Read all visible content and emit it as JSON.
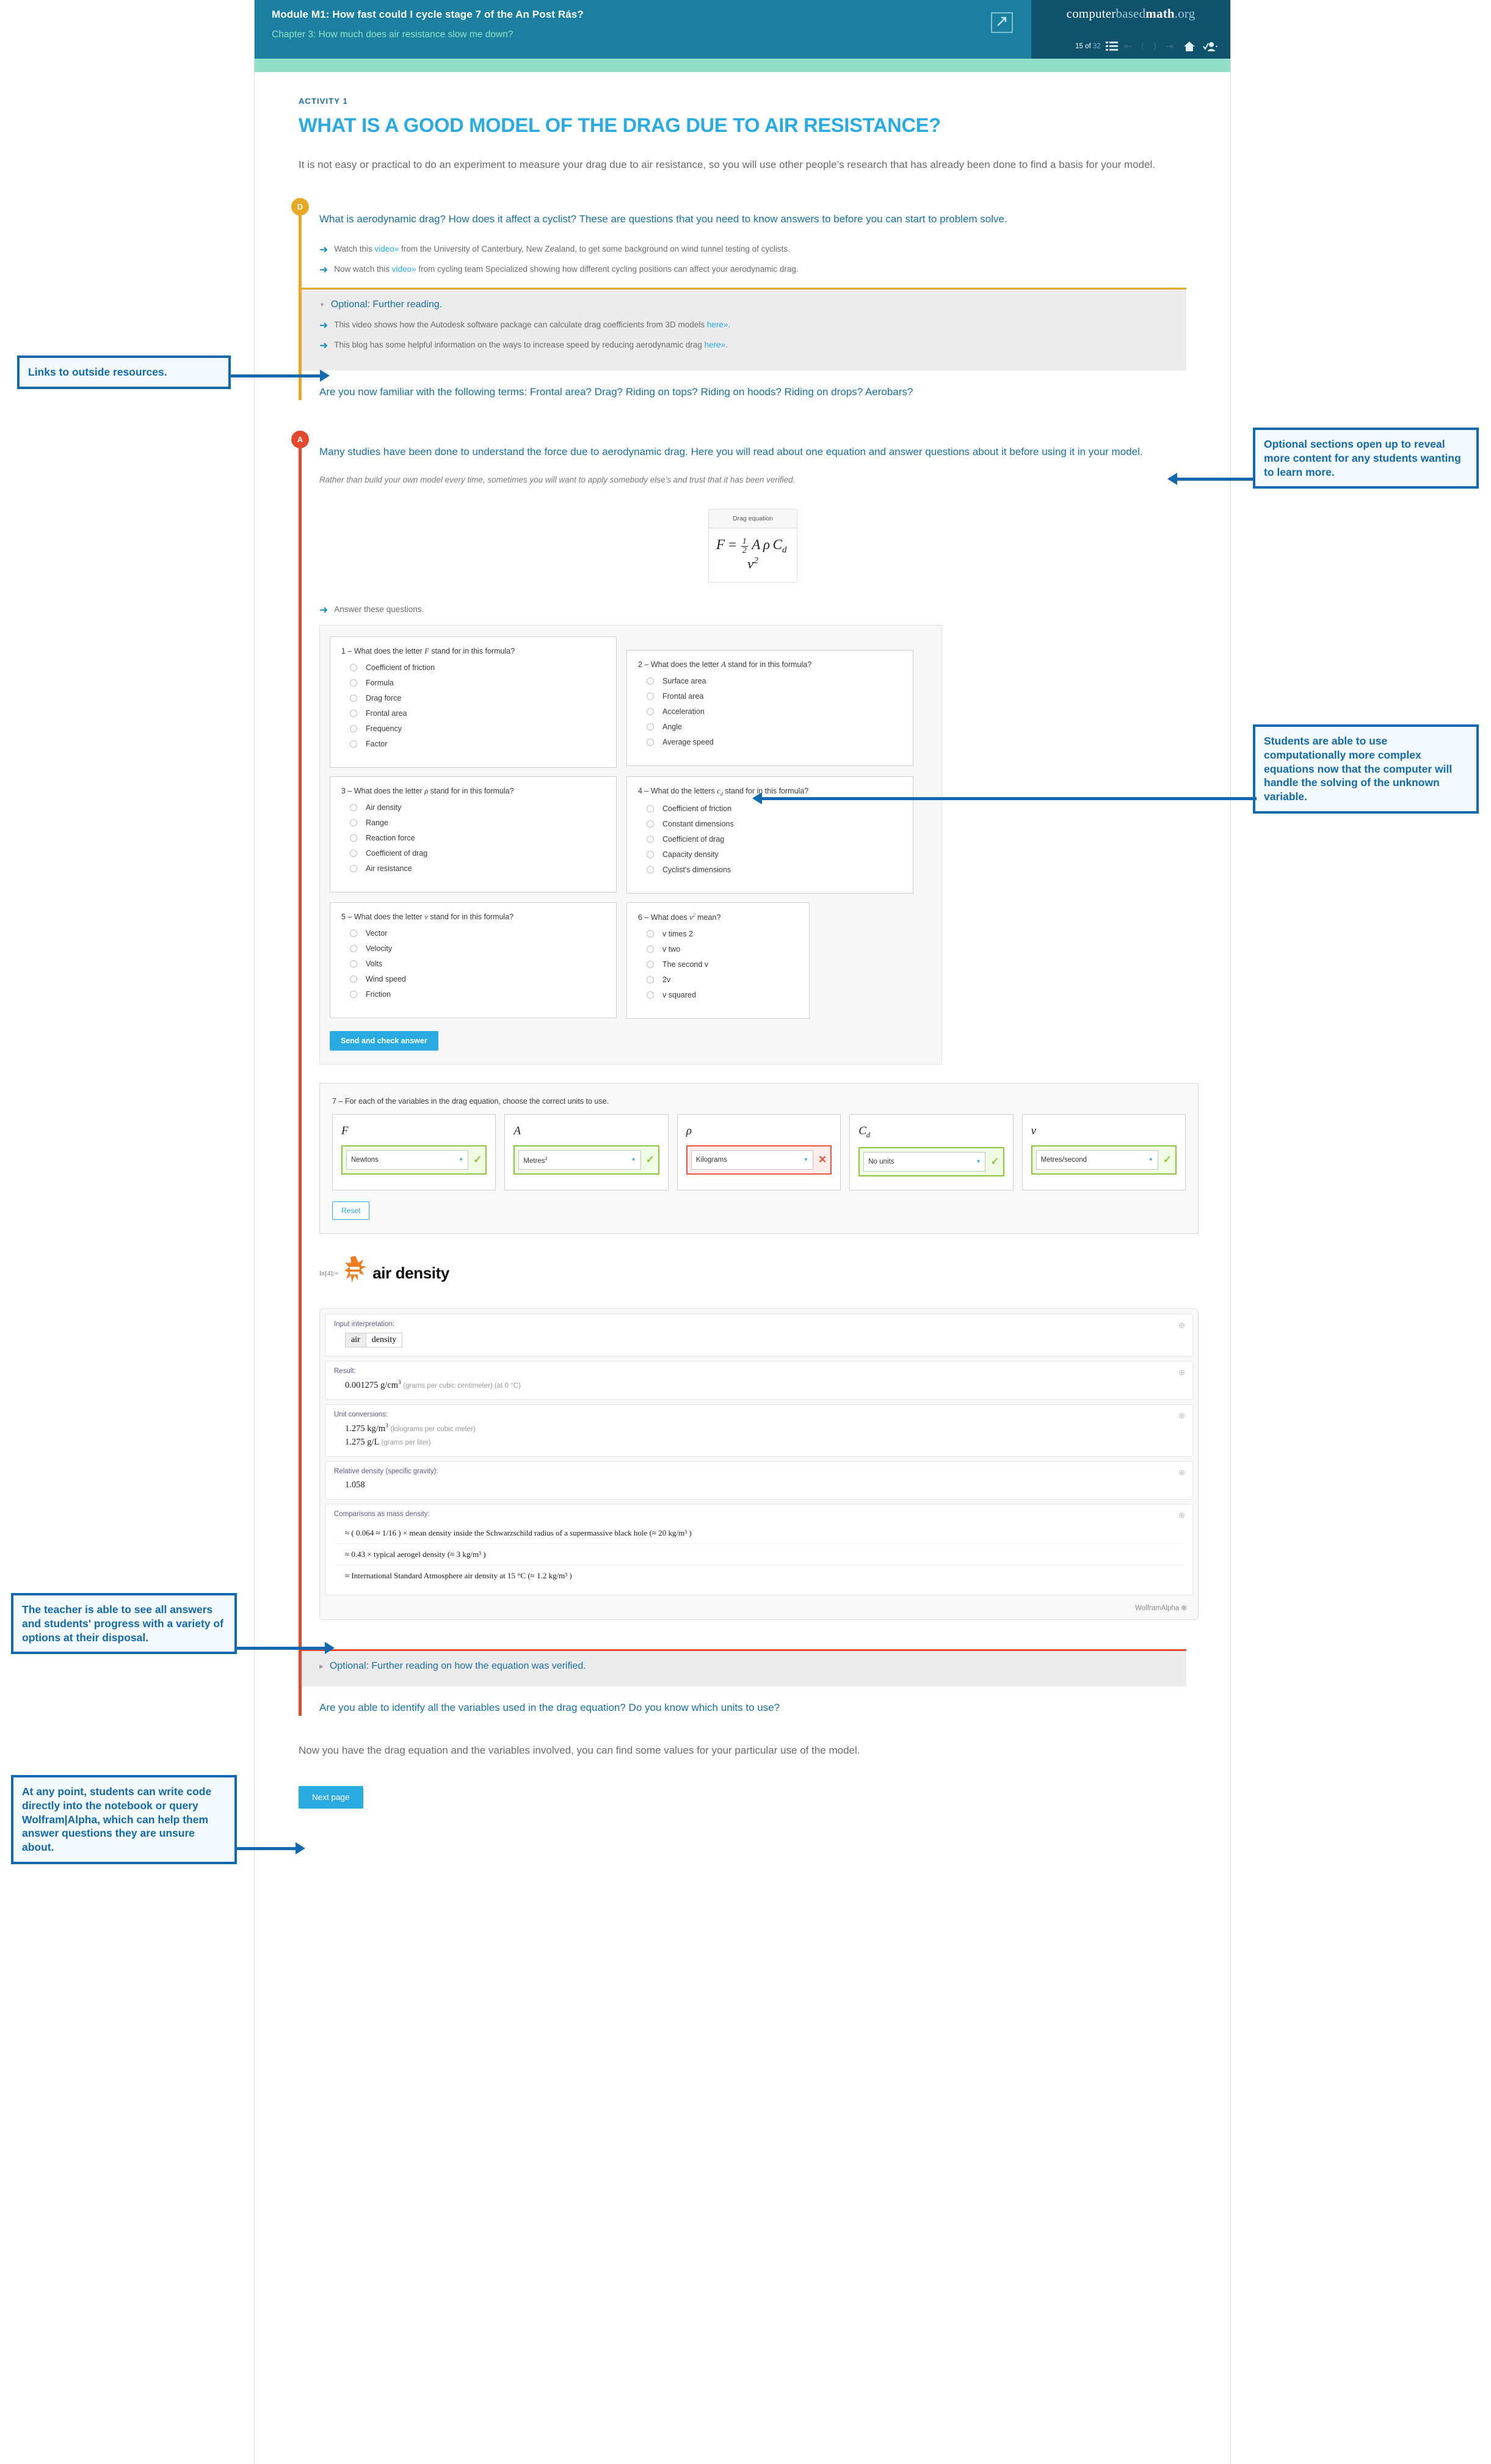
{
  "header": {
    "module_title": "Module M1: How fast could I cycle stage 7 of the An Post Rás?",
    "chapter_title": "Chapter 3: How much does air resistance slow me down?",
    "brand_computer": "computer",
    "brand_based": "based",
    "brand_math": "math",
    "brand_org": ".org",
    "page_current": "15 of",
    "page_total": "32",
    "expand_icon": "external-link-icon",
    "nav": [
      "list-icon",
      "first-page-icon",
      "prev-page-icon",
      "next-page-icon",
      "last-page-icon",
      "home-icon",
      "user-account-icon"
    ]
  },
  "page": {
    "kicker": "ACTIVITY 1",
    "title": "WHAT IS A GOOD MODEL OF THE DRAG DUE TO AIR RESISTANCE?",
    "intro": "It is not easy or practical to do an experiment to measure your drag due to air resistance, so you will use other people’s research that has already been done to find a basis for your model."
  },
  "section_d": {
    "badge": "D",
    "lead": "What is aerodynamic drag? How does it affect a cyclist? These are questions that you need to know answers to before you can start to problem solve.",
    "bullets": [
      {
        "pre": "Watch this ",
        "link": "video»",
        "post": " from the University of Canterbury, New Zealand, to get some background on wind tunnel testing of cyclists."
      },
      {
        "pre": "Now watch this ",
        "link": "video»",
        "post": " from cycling team Specialized showing how different cycling positions can affect your aerodynamic drag."
      }
    ],
    "optional_heading": "Optional: Further reading.",
    "optional_bullets": [
      {
        "pre": "This video shows how the Autodesk software package can calculate drag coefficients from 3D models ",
        "link": "here»",
        "post": "."
      },
      {
        "pre": "This blog has some helpful information on the ways to increase speed by reducing aerodynamic drag ",
        "link": "here»",
        "post": "."
      }
    ],
    "closing": "Are you now familiar with the following terms: Frontal area? Drag? Riding on tops? Riding on hoods? Riding on drops? Aerobars?"
  },
  "section_a": {
    "badge": "A",
    "lead": "Many studies have been done to understand the force due to aerodynamic drag. Here you will read about one equation and answer questions about it before using it in your model.",
    "note": "Rather than build your own model every time, sometimes you will want to apply somebody else’s and trust that it has been verified.",
    "equation_card_title": "Drag equation",
    "equation_plain": "F = 1/2 A ρ C_d v^2",
    "answer_prompt": "Answer these questions."
  },
  "quiz": {
    "questions": [
      {
        "num": "1",
        "prompt_pre": "1 – What does the letter ",
        "var": "F",
        "prompt_post": " stand for in this formula?",
        "options": [
          "Coefficient of friction",
          "Formula",
          "Drag force",
          "Frontal area",
          "Frequency",
          "Factor"
        ]
      },
      {
        "num": "2",
        "prompt_pre": "2 – What does the letter ",
        "var": "A",
        "prompt_post": " stand for in this formula?",
        "options": [
          "Surface area",
          "Frontal area",
          "Acceleration",
          "Angle",
          "Average speed"
        ]
      },
      {
        "num": "3",
        "prompt_pre": "3 – What does the letter ",
        "var": "ρ",
        "prompt_post": " stand for in this formula?",
        "options": [
          "Air density",
          "Range",
          "Reaction force",
          "Coefficient of drag",
          "Air resistance"
        ]
      },
      {
        "num": "4",
        "prompt_pre": "4 – What do the letters ",
        "var": "cₓ",
        "prompt_post": " stand for in this formula?",
        "options": [
          "Coefficient of friction",
          "Constant dimensions",
          "Coefficient of drag",
          "Capacity density",
          "Cyclist's dimensions"
        ]
      },
      {
        "num": "5",
        "prompt_pre": "5 – What does the letter ",
        "var": "v",
        "prompt_post": " stand for in this formula?",
        "options": [
          "Vector",
          "Velocity",
          "Volts",
          "Wind speed",
          "Friction"
        ]
      },
      {
        "num": "6",
        "prompt_pre": "6 – What does ",
        "var": "v²",
        "prompt_post": " mean?",
        "options": [
          "v times 2",
          "v two",
          "The second v",
          "2v",
          "v squared"
        ]
      }
    ],
    "send_label": "Send and check answer"
  },
  "units": {
    "question": "7 – For each of the variables in the drag equation, choose the correct units to use.",
    "fields": [
      {
        "var": "F",
        "value": "Newtons",
        "state": "correct",
        "mark": "✓"
      },
      {
        "var": "A",
        "value": "Metres²",
        "state": "correct",
        "mark": "✓"
      },
      {
        "var": "ρ",
        "value": "Kilograms",
        "state": "incorrect",
        "mark": "✕"
      },
      {
        "var": "C_d",
        "value": "No units",
        "state": "correct",
        "mark": "✓"
      },
      {
        "var": "v",
        "value": "Metres/second",
        "state": "correct",
        "mark": "✓"
      }
    ],
    "reset_label": "Reset"
  },
  "wolfram": {
    "in_label": "In[4]:=",
    "query": "air density",
    "pods": [
      {
        "title": "Input interpretation:",
        "chip": [
          "air",
          "density"
        ]
      },
      {
        "title": "Result:",
        "value": "0.001275 g/cm",
        "sup": "3",
        "note": "(grams per cubic centimeter)  (at 0 °C)"
      },
      {
        "title": "Unit conversions:",
        "value": "1.275 kg/m",
        "sup": "3",
        "note": "(kilograms per cubic meter)",
        "value2": "1.275 g/L",
        "note2": "(grams per liter)"
      },
      {
        "title": "Relative density (specific gravity):",
        "value": "1.058"
      },
      {
        "title": "Comparisons as mass density:",
        "comparisons": [
          "≈ ( 0.064 ≈ 1/16 ) × mean density inside the Schwarzschild radius of a supermassive black hole (≈ 20 kg/m³ )",
          "≈ 0.43 × typical aerogel density (≈ 3 kg/m³ )",
          "≈ International Standard Atmosphere air density at 15 °C (≈ 1.2 kg/m³ )"
        ]
      }
    ],
    "footer": "WolframAlpha"
  },
  "bottom": {
    "optional_heading": "Optional: Further reading on how the equation was verified.",
    "question": "Are you able to identify all the variables used in the drag equation? Do you know which units to use?",
    "outro": "Now you have the drag equation and the variables involved, you can find some values for your particular use of the model.",
    "next_label": "Next page"
  },
  "annotations": {
    "a1": "Links to outside resources.",
    "a2": "Optional sections open up to reveal more content for any students wanting to learn more.",
    "a3": "Students are able to use computationally more complex equations now that the computer will handle the solving of the unknown variable.",
    "a4": "The teacher is able to see all answers and students' progress with a variety of options at their disposal.",
    "a5": "At any point, students can write code directly into the notebook or query Wolfram|Alpha, which can help them answer questions they are unsure about."
  }
}
